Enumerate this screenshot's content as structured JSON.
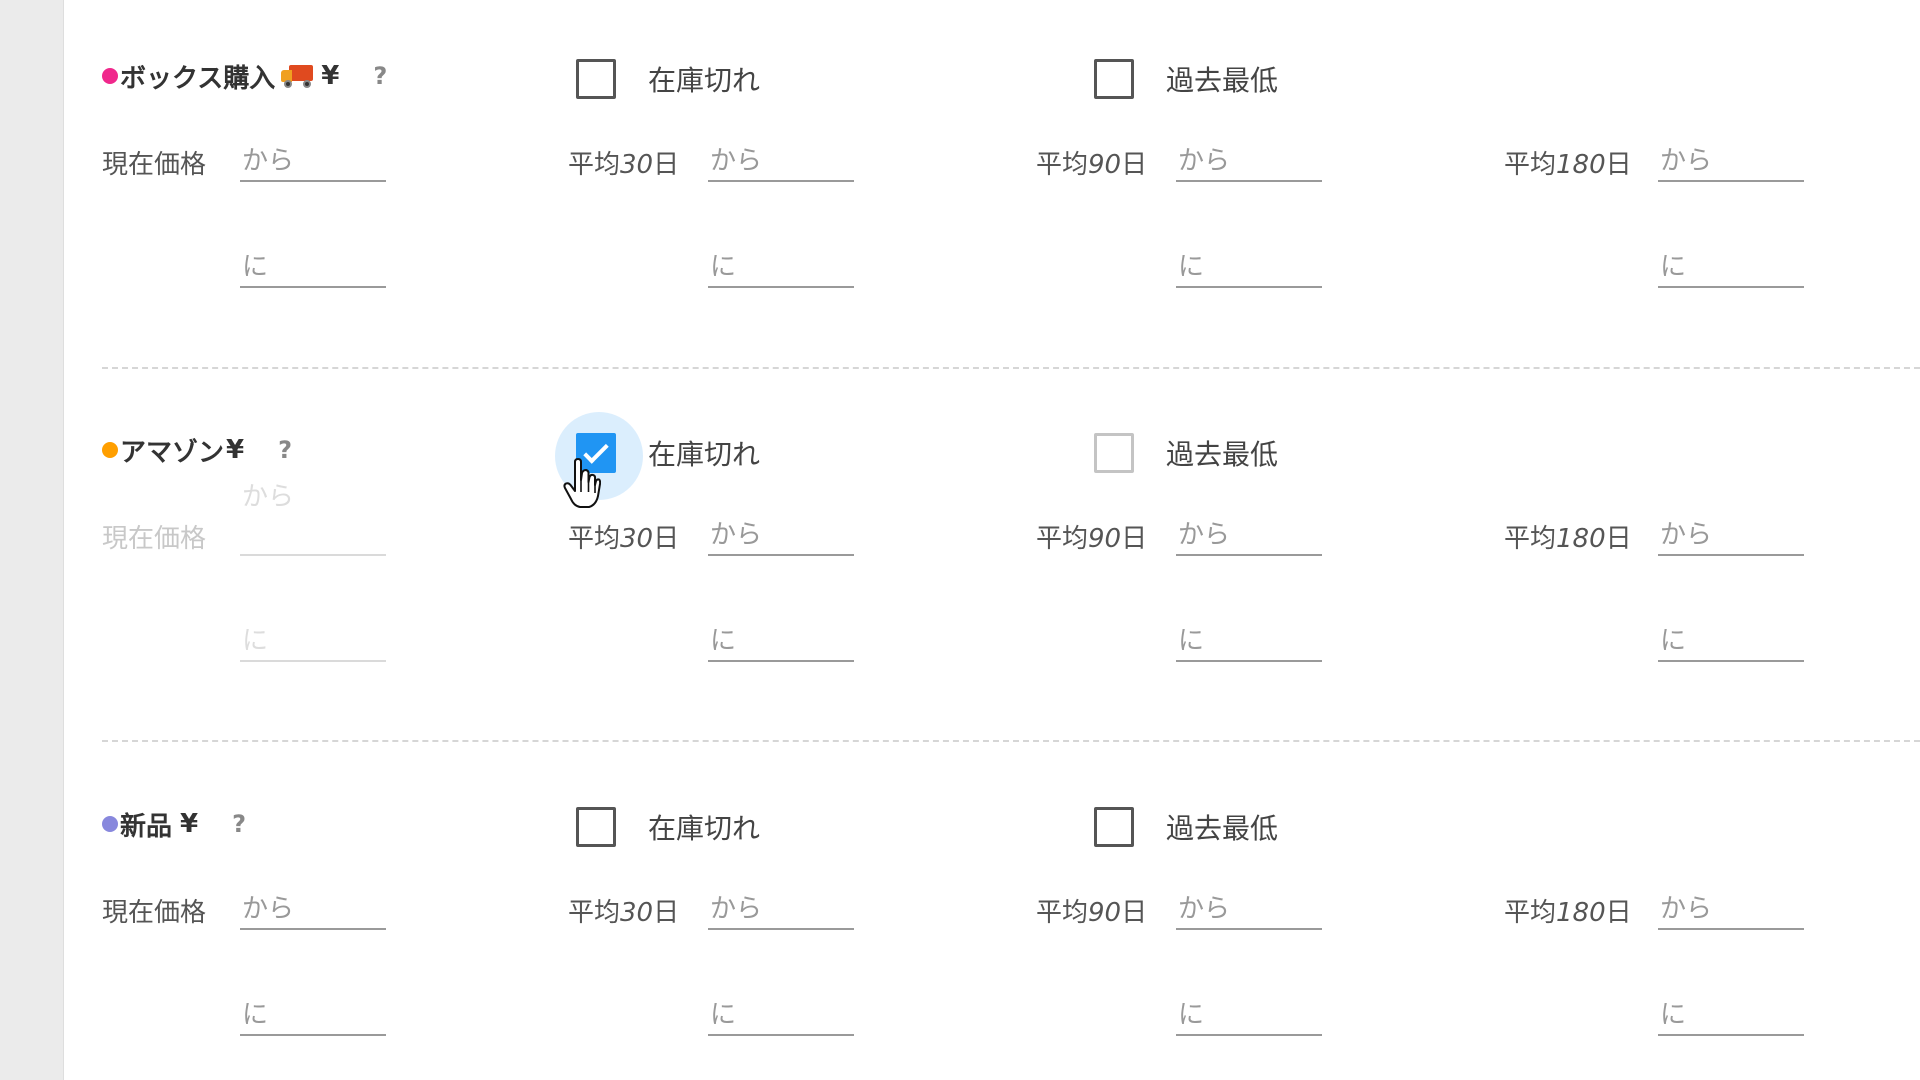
{
  "sections": [
    {
      "title": "ボックス購入",
      "currency": "¥",
      "help": "?",
      "dot_color": "#f0288c",
      "has_truck_icon": true,
      "out_of_stock": {
        "label": "在庫切れ",
        "checked": false
      },
      "all_time_low": {
        "label": "過去最低",
        "checked": false
      },
      "current_price_label": "現在価格",
      "avg30": {
        "prefix": "平均",
        "num": "30",
        "suffix": "日"
      },
      "avg90": {
        "prefix": "平均",
        "num": "90",
        "suffix": "日"
      },
      "avg180": {
        "prefix": "平均",
        "num": "180",
        "suffix": "日"
      },
      "from_placeholder": "から",
      "to_placeholder": "に"
    },
    {
      "title": "アマゾン",
      "currency": "¥",
      "help": "?",
      "dot_color": "#ff9f00",
      "has_truck_icon": false,
      "out_of_stock": {
        "label": "在庫切れ",
        "checked": true
      },
      "all_time_low": {
        "label": "過去最低",
        "checked": false
      },
      "current_price_label": "現在価格",
      "current_price_disabled": true,
      "avg30": {
        "prefix": "平均",
        "num": "30",
        "suffix": "日"
      },
      "avg90": {
        "prefix": "平均",
        "num": "90",
        "suffix": "日"
      },
      "avg180": {
        "prefix": "平均",
        "num": "180",
        "suffix": "日"
      },
      "from_placeholder": "から",
      "to_placeholder": "に"
    },
    {
      "title": "新品",
      "currency": "¥",
      "help": "?",
      "dot_color": "#8888dd",
      "has_truck_icon": false,
      "out_of_stock": {
        "label": "在庫切れ",
        "checked": false
      },
      "all_time_low": {
        "label": "過去最低",
        "checked": false
      },
      "current_price_label": "現在価格",
      "avg30": {
        "prefix": "平均",
        "num": "30",
        "suffix": "日"
      },
      "avg90": {
        "prefix": "平均",
        "num": "90",
        "suffix": "日"
      },
      "avg180": {
        "prefix": "平均",
        "num": "180",
        "suffix": "日"
      },
      "from_placeholder": "から",
      "to_placeholder": "に"
    }
  ],
  "colors": {
    "checkbox_checked": "#2196f3",
    "divider": "#d6d6d6",
    "left_rail": "#ebebeb"
  },
  "cursor": {
    "type": "hand-pointer"
  }
}
